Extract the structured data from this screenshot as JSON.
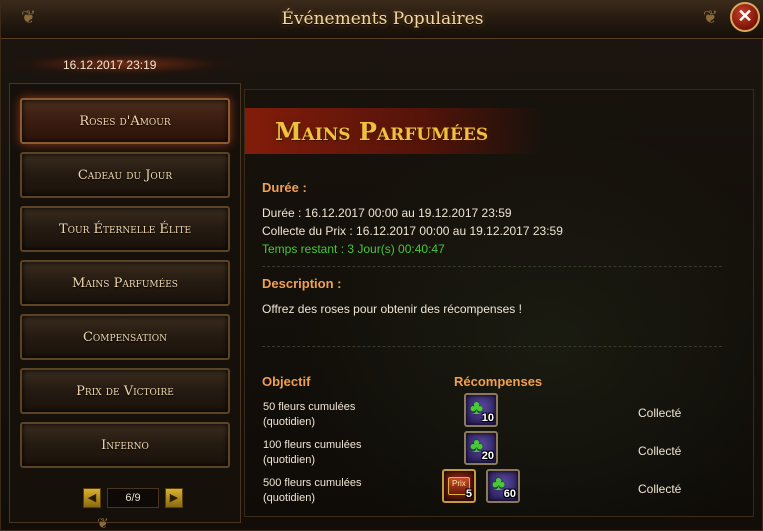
{
  "window": {
    "title": "Événements Populaires",
    "close_glyph": "✕",
    "title_ornament_left": "❦",
    "title_ornament_right": "❦"
  },
  "date": "16.12.2017 23:19",
  "menu": {
    "items": [
      {
        "label": "Roses d'Amour",
        "active": true
      },
      {
        "label": "Cadeau du Jour",
        "active": false
      },
      {
        "label": "Tour Éternelle Élite",
        "active": false
      },
      {
        "label": "Mains Parfumées",
        "active": false
      },
      {
        "label": "Compensation",
        "active": false
      },
      {
        "label": "Prix de Victoire",
        "active": false
      },
      {
        "label": "Inferno",
        "active": false
      }
    ],
    "pager": {
      "text": "6/9",
      "prev_glyph": "◀",
      "next_glyph": "▶"
    }
  },
  "event": {
    "title": "Mains Parfumées",
    "duration_heading": "Durée :",
    "duration_line": "Durée : 16.12.2017 00:00 au 19.12.2017 23:59",
    "collect_line": "Collecte du Prix : 16.12.2017 00:00 au 19.12.2017 23:59",
    "remaining_line": "Temps restant : 3 Jour(s)  00:40:47",
    "description_heading": "Description :",
    "description_text": "Offrez des roses pour obtenir des récompenses !",
    "objective_heading": "Objectif",
    "rewards_heading": "Récompenses",
    "objectives": [
      {
        "text": "50 fleurs cumulées (quotidien)",
        "status": "Collecté",
        "rewards": [
          {
            "icon": "clover-icon",
            "qty": "10"
          }
        ]
      },
      {
        "text": "100 fleurs cumulées (quotidien)",
        "status": "Collecté",
        "rewards": [
          {
            "icon": "clover-icon",
            "qty": "20"
          }
        ]
      },
      {
        "text": "500 fleurs cumulées (quotidien)",
        "status": "Collecté",
        "rewards": [
          {
            "icon": "prize-chest-icon",
            "label": "Prix",
            "qty": "5"
          },
          {
            "icon": "clover-icon",
            "qty": "60"
          }
        ]
      }
    ]
  },
  "colors": {
    "accent_orange": "#f0a050",
    "title_gold": "#f2c040",
    "remaining_green": "#46c83a"
  }
}
